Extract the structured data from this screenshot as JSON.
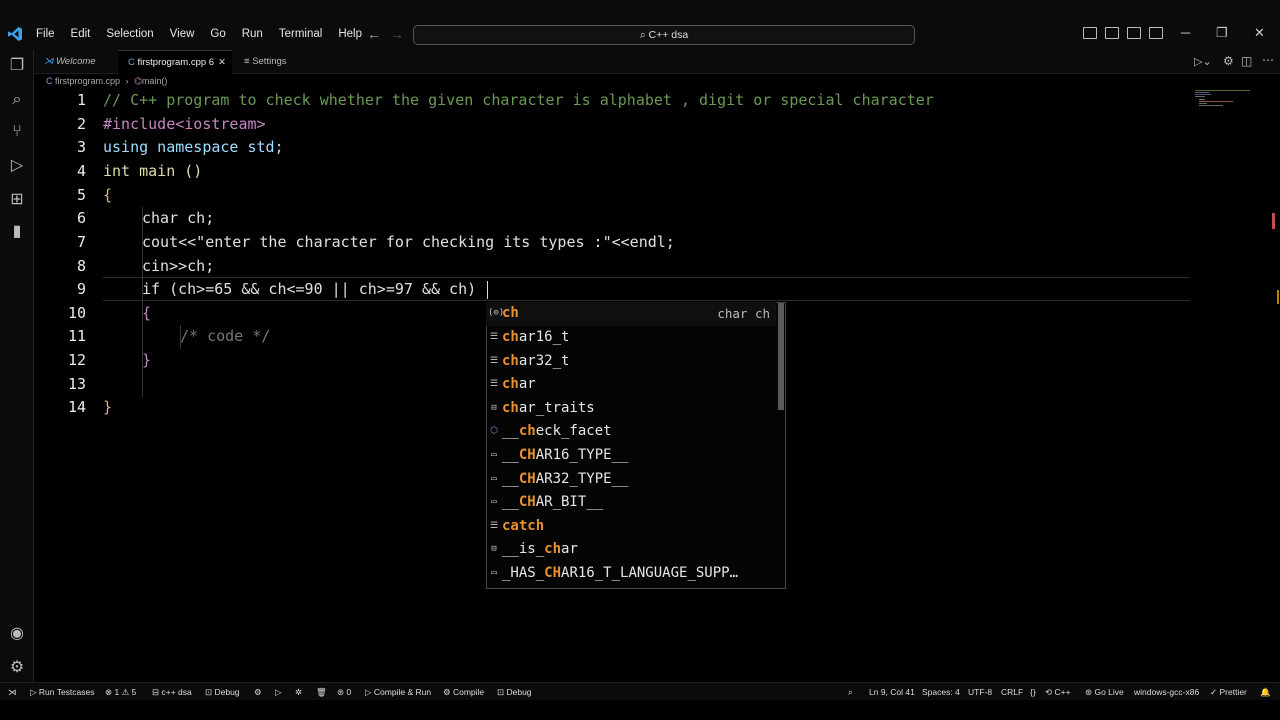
{
  "menu": [
    "File",
    "Edit",
    "Selection",
    "View",
    "Go",
    "Run",
    "Terminal",
    "Help"
  ],
  "command_center": "C++ dsa",
  "tabs": [
    {
      "label": "Welcome"
    },
    {
      "label": "firstprogram.cpp 6"
    },
    {
      "label": "Settings"
    }
  ],
  "breadcrumb": {
    "file": "firstprogram.cpp",
    "symbol": "main()"
  },
  "editor": {
    "line_numbers": [
      "1",
      "2",
      "3",
      "4",
      "5",
      "6",
      "7",
      "8",
      "9",
      "10",
      "11",
      "12",
      "13",
      "14"
    ],
    "lines": [
      "// C++ program to check whether the given character is alphabet , digit or special character",
      "#include<iostream>",
      "using namespace std;",
      "int main ()",
      "{",
      "char ch;",
      "cout<<\"enter the character for checking its types :\"<<endl;",
      "cin>>ch;",
      "if (ch>=65 && ch<=90 || ch>=97 && ch)",
      "{",
      "/* code */",
      "}",
      "",
      "}"
    ]
  },
  "suggestions": [
    {
      "prefix": "",
      "match": "ch",
      "rest": "",
      "icon": "variable-icon",
      "detail": "char ch"
    },
    {
      "prefix": "",
      "match": "ch",
      "rest": "ar16_t",
      "icon": "keyword-icon"
    },
    {
      "prefix": "",
      "match": "ch",
      "rest": "ar32_t",
      "icon": "keyword-icon"
    },
    {
      "prefix": "",
      "match": "ch",
      "rest": "ar",
      "icon": "keyword-icon"
    },
    {
      "prefix": "",
      "match": "ch",
      "rest": "ar_traits",
      "icon": "struct-icon"
    },
    {
      "prefix": "__",
      "match": "ch",
      "rest": "eck_facet",
      "icon": "cube-icon"
    },
    {
      "prefix": "__",
      "match": "CH",
      "rest": "AR16_TYPE__",
      "icon": "constant-icon"
    },
    {
      "prefix": "__",
      "match": "CH",
      "rest": "AR32_TYPE__",
      "icon": "constant-icon"
    },
    {
      "prefix": "__",
      "match": "CH",
      "rest": "AR_BIT__",
      "icon": "constant-icon"
    },
    {
      "prefix": "",
      "match": "catch",
      "rest": "",
      "icon": "keyword-icon"
    },
    {
      "prefix": "__is_",
      "match": "ch",
      "rest": "ar",
      "icon": "struct-icon"
    },
    {
      "prefix": "_HAS_",
      "match": "CH",
      "rest": "AR16_T_LANGUAGE_SUPP…",
      "icon": "constant-icon"
    }
  ],
  "status": {
    "run_testcases": "Run Testcases",
    "problems": "1 ⚠ 5",
    "workspace": "c++ dsa",
    "debug": "Debug",
    "ports": "0",
    "compile_run": "Compile & Run",
    "compile": "Compile",
    "debug2": "Debug",
    "position": "Ln 9, Col 41",
    "spaces": "Spaces: 4",
    "encoding": "UTF-8",
    "eol": "CRLF",
    "language": "C++",
    "golive": "Go Live",
    "platform": "windows-gcc-x86",
    "prettier": "Prettier"
  }
}
